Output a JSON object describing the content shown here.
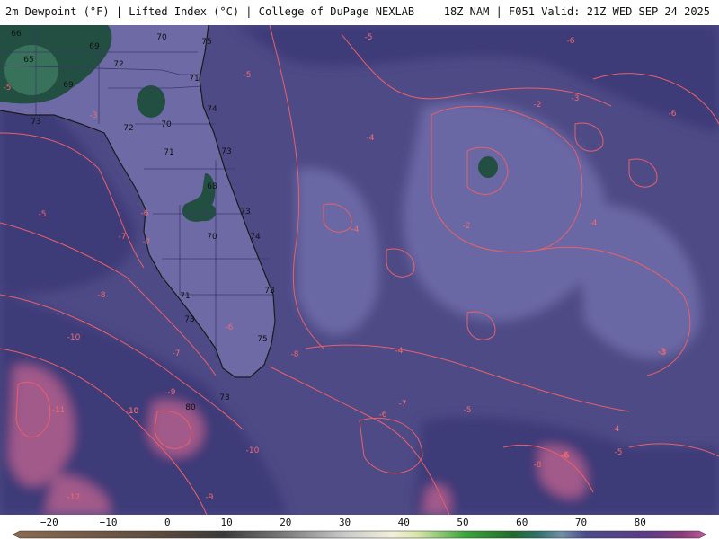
{
  "header": {
    "title_left": "2m Dewpoint (°F) | Lifted Index (°C) | College of DuPage NEXLAB",
    "title_right": "18Z NAM | F051 Valid: 21Z WED SEP 24 2025"
  },
  "legend": {
    "min": -25,
    "max": 90,
    "ticks": [
      "−20",
      "−10",
      "0",
      "10",
      "20",
      "30",
      "40",
      "50",
      "60",
      "70",
      "80"
    ],
    "tick_values": [
      -20,
      -10,
      0,
      10,
      20,
      30,
      40,
      50,
      60,
      70,
      80
    ],
    "stops": [
      [
        -25,
        "#8a6a4f"
      ],
      [
        0,
        "#5b4a3c"
      ],
      [
        10,
        "#3a3a3a"
      ],
      [
        20,
        "#7a7a7a"
      ],
      [
        30,
        "#c9c9c9"
      ],
      [
        38,
        "#f2f0d8"
      ],
      [
        42,
        "#d9e6a8"
      ],
      [
        50,
        "#3aa63a"
      ],
      [
        58,
        "#1f6b2a"
      ],
      [
        62,
        "#2f6f6a"
      ],
      [
        66,
        "#6f8fa8"
      ],
      [
        70,
        "#4a4a8a"
      ],
      [
        80,
        "#5a3a8a"
      ],
      [
        86,
        "#8a3a7a"
      ],
      [
        90,
        "#c05a9a"
      ]
    ]
  },
  "colors": {
    "ocean": "#4e4a86",
    "ocean_dark": "#3d3a78",
    "ocean_light": "#6a67a4",
    "land": "#6e6aa6",
    "dry_pink": "#a25a8a",
    "moist_green": "#234f42",
    "contour": "#e8606a",
    "border": "#1a1a1a"
  },
  "map": {
    "dewpoint_labels": [
      "68",
      "66",
      "65",
      "69",
      "70",
      "72",
      "75",
      "71",
      "69",
      "73",
      "72",
      "70",
      "74",
      "71",
      "73",
      "68",
      "73",
      "70",
      "74",
      "73",
      "71",
      "73",
      "75",
      "73",
      "80"
    ],
    "lifted_index_labels": [
      "-5",
      "-6",
      "-5",
      "-5",
      "-3",
      "-4",
      "-2",
      "-3",
      "-4",
      "-2",
      "-4",
      "-3",
      "-6",
      "-5",
      "-7",
      "-6",
      "-7",
      "-8",
      "-10",
      "-7",
      "-6",
      "-8",
      "-9",
      "-10",
      "-4",
      "-7",
      "-6",
      "-5",
      "-4",
      "-6",
      "-5",
      "-3",
      "-11",
      "-10",
      "-12",
      "-10",
      "-9",
      "-8",
      "-6"
    ]
  }
}
